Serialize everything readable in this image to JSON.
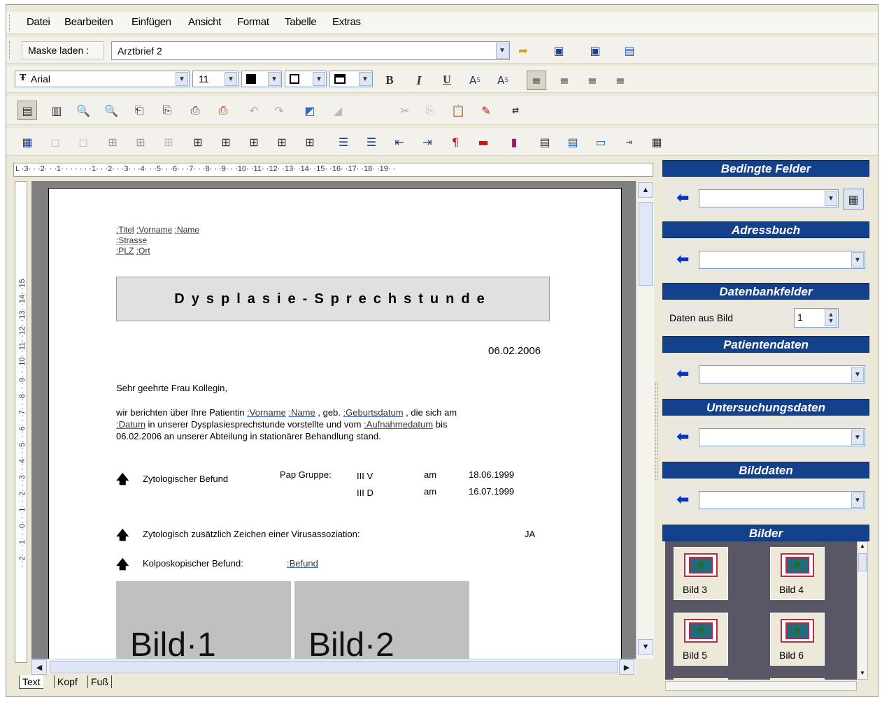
{
  "menu": [
    "Datei",
    "Bearbeiten",
    "Einfügen",
    "Ansicht",
    "Format",
    "Tabelle",
    "Extras"
  ],
  "mask": {
    "label": "Maske laden :",
    "value": "Arztbrief 2"
  },
  "format": {
    "font": "Arial",
    "size": "11",
    "bold": "B",
    "italic": "I",
    "underline": "U",
    "superscript": "A",
    "superscript_mark": "S",
    "subscript": "A",
    "subscript_mark": "S"
  },
  "ruler": {
    "horizontal": "L ·3· · ·2· · ·1· · · · · · ·1· · ·2· · ·3· · ·4· · ·5· · ·6· · ·7· · ·8· · ·9· · ·10· ·11· ·12· ·13· ·14· ·15· ·16· ·17· ·18· ·19· ·",
    "vertical": "· ·2· · ·1· · ·0· · ·1· · ·2· · ·3· · ·4· · ·5· · ·6· · ·7· · ·8· · ·9· · ·10· ·11· ·12· ·13· ·14· ·15"
  },
  "doc": {
    "address": {
      "line1": [
        ":Titel",
        ":Vorname",
        ":Name"
      ],
      "line2": ":Strasse",
      "line3": [
        ":PLZ",
        ":Ort"
      ]
    },
    "title": "Dysplasie-Sprechstunde",
    "date": "06.02.2006",
    "salutation": "Sehr geehrte Frau Kollegin,",
    "paragraph": {
      "p1": "wir berichten über Ihre Patientin",
      "f1": ":Vorname",
      "f2": ":Name",
      "p2": ", geb.",
      "f3": ":Geburtsdatum",
      "p3": ", die sich am",
      "f4": ":Datum",
      "p4": "in unserer Dysplasiesprechstunde vorstellte und vom",
      "f5": ":Aufnahmedatum",
      "p5": "bis",
      "line3": "06.02.2006 an unserer Abteilung in stationärer Behandlung stand."
    },
    "zyto": {
      "label": "Zytologischer Befund",
      "pap": "Pap Gruppe:",
      "r1": [
        "III V",
        "am",
        "18.06.1999"
      ],
      "r2": [
        "III D",
        "am",
        "16.07.1999"
      ]
    },
    "viral": {
      "label": "Zytologisch zusätzlich Zeichen einer Virusassoziation:",
      "value": "JA"
    },
    "kolpo": {
      "label": "Kolposkopischer Befund:",
      "field": ":Befund"
    },
    "images": [
      "Bild·1",
      "Bild·2"
    ]
  },
  "tabs": [
    "Text",
    "Kopf",
    "Fuß"
  ],
  "panel": {
    "bedingte": "Bedingte Felder",
    "adress": "Adressbuch",
    "datenbank": "Datenbankfelder",
    "daten_aus_bild": "Daten aus Bild",
    "bild_index": "1",
    "patient": "Patientendaten",
    "untersuchung": "Untersuchungsdaten",
    "bilddaten": "Bilddaten",
    "bilder": "Bilder",
    "thumbs": [
      "Bild 3",
      "Bild 4",
      "Bild 5",
      "Bild 6"
    ]
  }
}
